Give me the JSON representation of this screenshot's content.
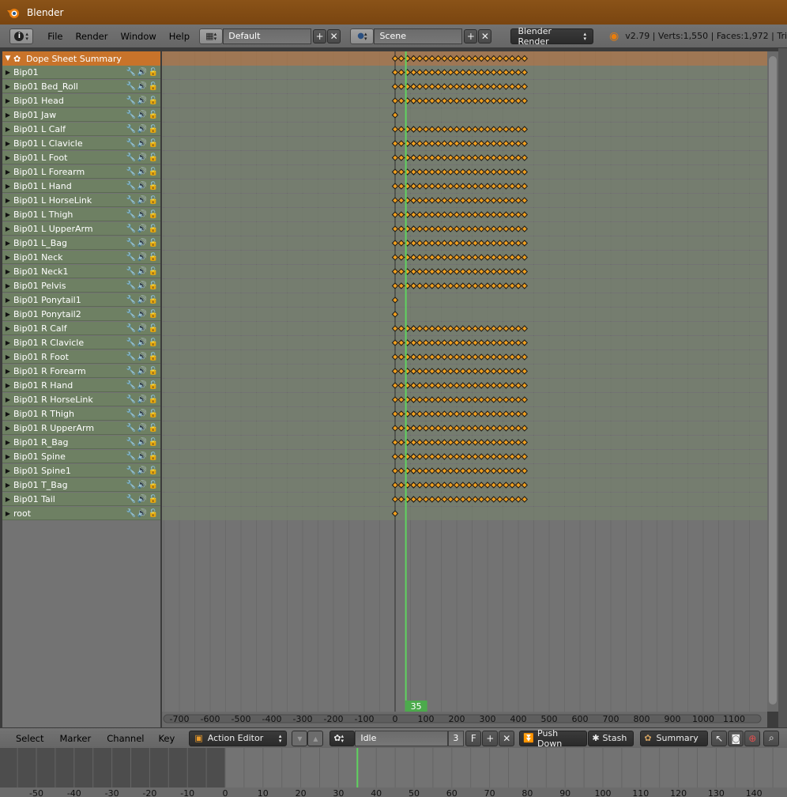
{
  "window": {
    "title": "Blender"
  },
  "menu": {
    "items": [
      "File",
      "Render",
      "Window",
      "Help"
    ]
  },
  "screen_layout": {
    "value": "Default"
  },
  "scene": {
    "value": "Scene"
  },
  "render_engine": {
    "value": "Blender Render"
  },
  "stats": {
    "text": "v2.79 | Verts:1,550 | Faces:1,972 | Tri"
  },
  "summary": {
    "label": "Dope Sheet Summary"
  },
  "channels": [
    "Bip01",
    "Bip01 Bed_Roll",
    "Bip01 Head",
    "Bip01 Jaw",
    "Bip01 L Calf",
    "Bip01 L Clavicle",
    "Bip01 L Foot",
    "Bip01 L Forearm",
    "Bip01 L Hand",
    "Bip01 L HorseLink",
    "Bip01 L Thigh",
    "Bip01 L UpperArm",
    "Bip01 L_Bag",
    "Bip01 Neck",
    "Bip01 Neck1",
    "Bip01 Pelvis",
    "Bip01 Ponytail1",
    "Bip01 Ponytail2",
    "Bip01 R Calf",
    "Bip01 R Clavicle",
    "Bip01 R Foot",
    "Bip01 R Forearm",
    "Bip01 R Hand",
    "Bip01 R HorseLink",
    "Bip01 R Thigh",
    "Bip01 R UpperArm",
    "Bip01 R_Bag",
    "Bip01 Spine",
    "Bip01 Spine1",
    "Bip01 T_Bag",
    "Bip01 Tail",
    "root"
  ],
  "single_key_channels": [
    "Bip01 Jaw",
    "Bip01 Ponytail1",
    "Bip01 Ponytail2",
    "root"
  ],
  "current_frame": "35",
  "dopesheet_ruler": [
    "-700",
    "-600",
    "-500",
    "-400",
    "-300",
    "-200",
    "-100",
    "0",
    "100",
    "200",
    "300",
    "400",
    "500",
    "600",
    "700",
    "800",
    "900",
    "1000",
    "1100"
  ],
  "bottom_menu": [
    "Select",
    "Marker",
    "Channel",
    "Key"
  ],
  "editor_mode": {
    "value": "Action Editor"
  },
  "action": {
    "name": "Idle",
    "users": "3",
    "fake_user": "F"
  },
  "buttons": {
    "push_down": "Push Down",
    "stash": "Stash",
    "summary": "Summary"
  },
  "timeline_ruler": [
    "-50",
    "-40",
    "-30",
    "-20",
    "-10",
    "0",
    "10",
    "20",
    "30",
    "40",
    "50",
    "60",
    "70",
    "80",
    "90",
    "100",
    "110",
    "120",
    "130",
    "140"
  ],
  "colors": {
    "title_bar": "#8a5318",
    "summary": "#c8732a",
    "channel": "#6e8063",
    "keyframe": "#f0a020",
    "playhead": "#5fd35f"
  }
}
